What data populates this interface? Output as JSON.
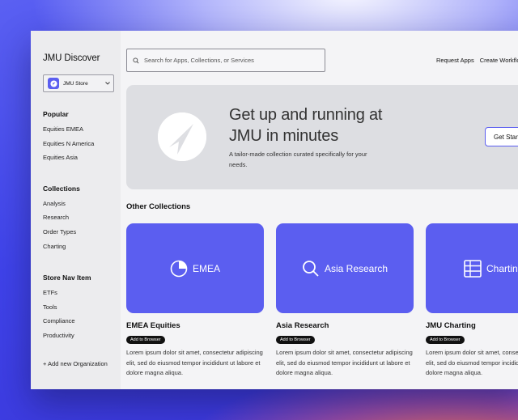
{
  "sidebar": {
    "app_title": "JMU Discover",
    "store_select": {
      "value": "JMU Store"
    },
    "sections": [
      {
        "heading": "Popular",
        "items": [
          "Equities EMEA",
          "Equities N America",
          "Equities Asia"
        ]
      },
      {
        "heading": "Collections",
        "items": [
          "Analysis",
          "Research",
          "Order Types",
          "Charting"
        ]
      },
      {
        "heading": "Store Nav Item",
        "items": [
          "ETFs",
          "Tools",
          "Compliance",
          "Productivity"
        ]
      }
    ],
    "add_org": "+ Add new Organization"
  },
  "header": {
    "search_placeholder": "Search for Apps, Collections, or Services",
    "links": [
      "Request Apps",
      "Create Workflow"
    ]
  },
  "hero": {
    "title": "Get up and running at JMU in minutes",
    "subtitle": "A tailor-made collection curated specifically for your needs.",
    "button": "Get Started"
  },
  "other_collections": {
    "heading": "Other Collections",
    "cards": [
      {
        "image_label": "EMEA",
        "icon": "pie-chart-icon",
        "title": "EMEA Equities",
        "badge": "Add to Browser",
        "description": "Lorem ipsum dolor sit amet, consectetur adipiscing elit, sed do eiusmod tempor incididunt ut labore et dolore magna aliqua."
      },
      {
        "image_label": "Asia Research",
        "icon": "search-icon",
        "title": "Asia Research",
        "badge": "Add to Browser",
        "description": "Lorem ipsum dolor sit amet, consectetur adipiscing elit, sed do eiusmod tempor incididunt ut labore et dolore magna aliqua."
      },
      {
        "image_label": "Charting",
        "icon": "grid-icon",
        "title": "JMU Charting",
        "badge": "Add to Browser",
        "description": "Lorem ipsum dolor sit amet, consectetur adipiscing elit, sed do eiusmod tempor incididunt ut labore et dolore magna aliqua."
      }
    ]
  },
  "colors": {
    "accent": "#5b5ef0",
    "sidebar_bg": "#ececee",
    "content_bg": "#f4f4f6",
    "hero_bg": "#dddee2"
  }
}
